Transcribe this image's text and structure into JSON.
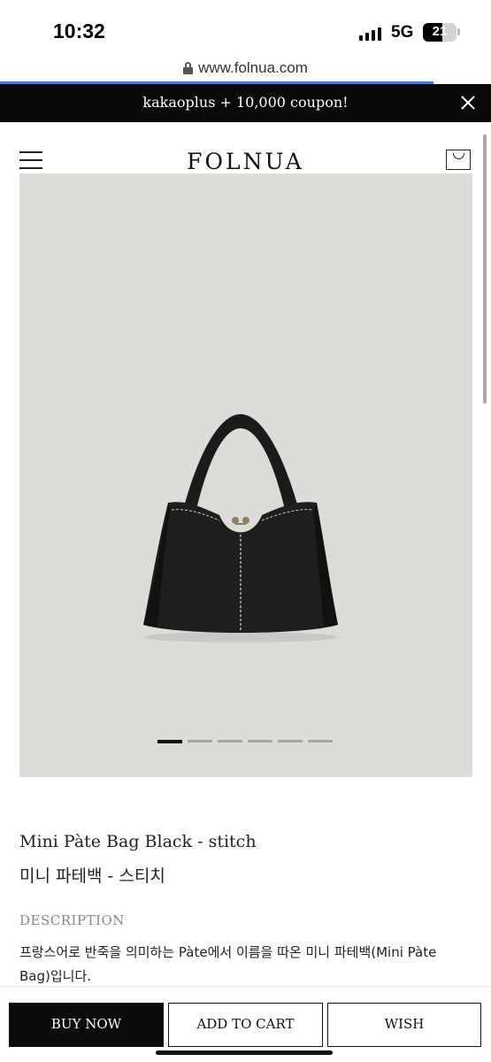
{
  "status_bar": {
    "time": "10:32",
    "network": "5G",
    "battery": "21"
  },
  "browser": {
    "url": "www.folnua.com"
  },
  "promo": {
    "text": "kakaoplus + 10,000 coupon!"
  },
  "header": {
    "logo": "FOLNUA"
  },
  "gallery": {
    "slide_count": 6,
    "active_slide": 1
  },
  "product": {
    "title_en": "Mini Pàte Bag Black - stitch",
    "title_ko": "미니 파테백 - 스티치",
    "description_label": "DESCRIPTION",
    "description": "프랑스어로 반죽을 의미하는 Pàte에서 이름을 따온 미니 파테백(Mini Pàte Bag)입니다."
  },
  "actions": {
    "buy_now": "BUY NOW",
    "add_to_cart": "ADD TO CART",
    "wish": "WISH"
  }
}
